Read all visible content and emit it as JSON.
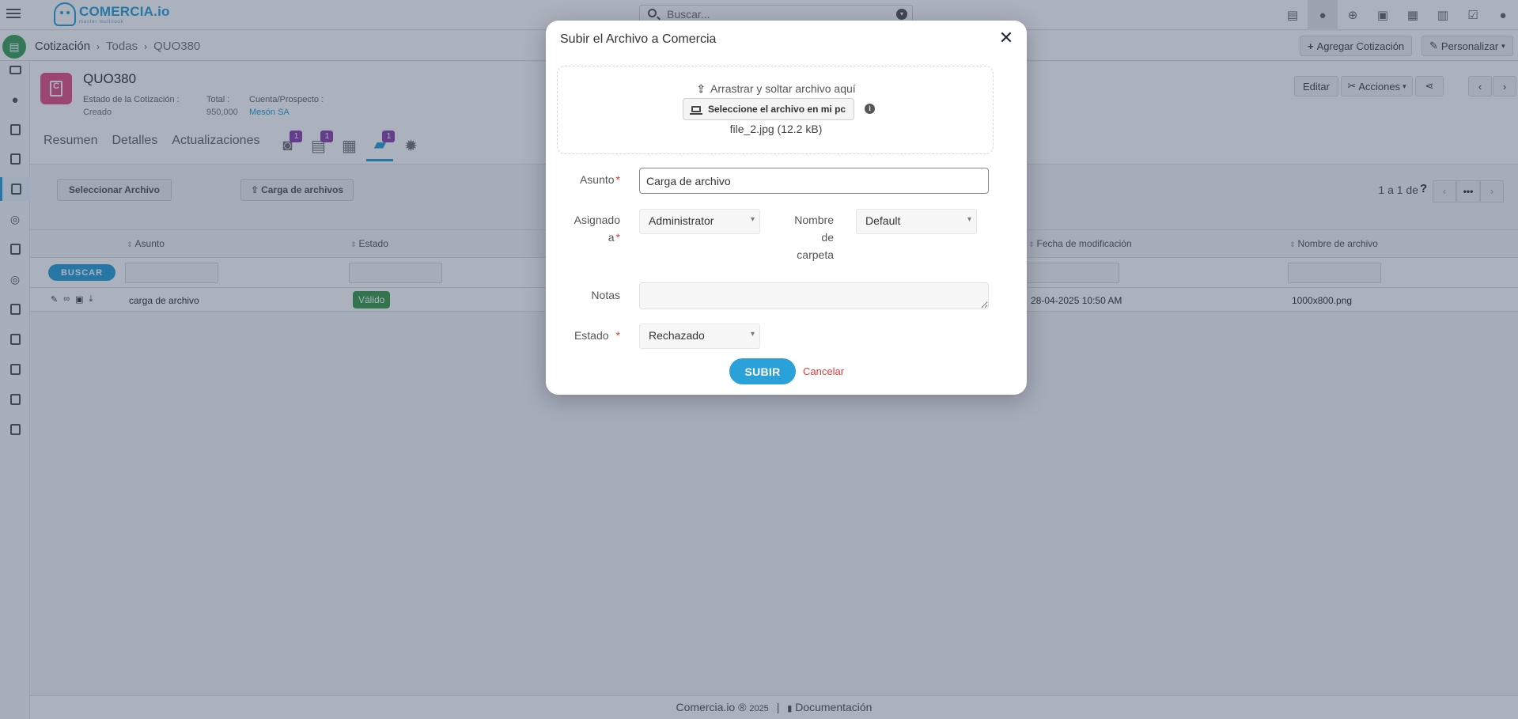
{
  "topbar": {
    "brand": "COMERCIA.io",
    "brand_tagline": "master multilook",
    "search_placeholder": "Buscar...",
    "icons": [
      "printer-icon",
      "alert-icon",
      "plus-icon",
      "calendar-check-icon",
      "calendar-icon",
      "chart-icon",
      "check-square-icon",
      "user-icon"
    ]
  },
  "breadcrumb": {
    "module": "Cotización",
    "list": "Todas",
    "record": "QUO380"
  },
  "subbar": {
    "add_label": "Agregar Cotización",
    "customize_label": "Personalizar"
  },
  "record": {
    "title": "QUO380",
    "fields": [
      {
        "label": "Estado de la Cotización :",
        "value": "Creado"
      },
      {
        "label": "Total :",
        "value": "950,000"
      },
      {
        "label": "Cuenta/Prospecto :",
        "value": "Mesón SA"
      }
    ],
    "edit_label": "Editar",
    "actions_label": "Acciones",
    "tabs": [
      "Resumen",
      "Detalles",
      "Actualizaciones"
    ],
    "tab_badges": {
      "comments": "1",
      "documents": "1",
      "files": "1"
    }
  },
  "list": {
    "select_file_label": "Seleccionar Archivo",
    "upload_files_label": "Carga de archivos",
    "pager_text": "1 a 1 de",
    "columns": {
      "subject": "Asunto",
      "status": "Estado",
      "modified": "Fecha de modificación",
      "filename": "Nombre de archivo"
    },
    "search_label": "BUSCAR",
    "rows": [
      {
        "subject": "carga de archivo",
        "status": "Válido",
        "modified": "28-04-2025 10:50 AM",
        "filename": "1000x800.png"
      }
    ]
  },
  "footer": {
    "brand": "Comercia.io ®",
    "year": "2025",
    "separator": "|",
    "docs": "Documentación"
  },
  "modal": {
    "title": "Subir el Archivo a Comercia",
    "drop_text": "Arrastrar y soltar archivo aquí",
    "select_pc_label": "Seleccione el archivo en mi pc",
    "file_name": "file_2.jpg (12.2 kB)",
    "subject_label": "Asunto",
    "subject_value": "Carga de archivo",
    "assigned_label_1": "Asignado",
    "assigned_label_2": "a",
    "assigned_value": "Administrator",
    "folder_label_1": "Nombre",
    "folder_label_2": "de",
    "folder_label_3": "carpeta",
    "folder_value": "Default",
    "notes_label": "Notas",
    "status_label": "Estado",
    "status_value": "Rechazado",
    "submit_label": "SUBIR",
    "cancel_label": "Cancelar"
  }
}
